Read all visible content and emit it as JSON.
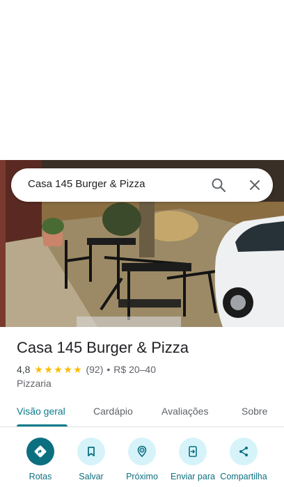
{
  "search": {
    "query": "Casa 145 Burger & Pizza"
  },
  "place": {
    "name": "Casa 145 Burger & Pizza",
    "rating": "4,8",
    "stars": 5,
    "reviews": "(92)",
    "separator": "•",
    "price": "R$ 20–40",
    "category": "Pizzaria"
  },
  "tabs": [
    {
      "label": "Visão geral",
      "active": true
    },
    {
      "label": "Cardápio"
    },
    {
      "label": "Avaliações"
    },
    {
      "label": "Sobre"
    }
  ],
  "actions": [
    {
      "label": "Rotas",
      "icon": "directions-icon"
    },
    {
      "label": "Salvar",
      "icon": "bookmark-icon"
    },
    {
      "label": "Próximo",
      "icon": "nearby-icon"
    },
    {
      "label": "Enviar para",
      "icon": "send-to-phone-icon"
    },
    {
      "label": "Compartilha",
      "icon": "share-icon"
    }
  ],
  "colors": {
    "accent": "#0b7a8a",
    "action_bg": "#d6f3fa",
    "star": "#fbbc04"
  }
}
